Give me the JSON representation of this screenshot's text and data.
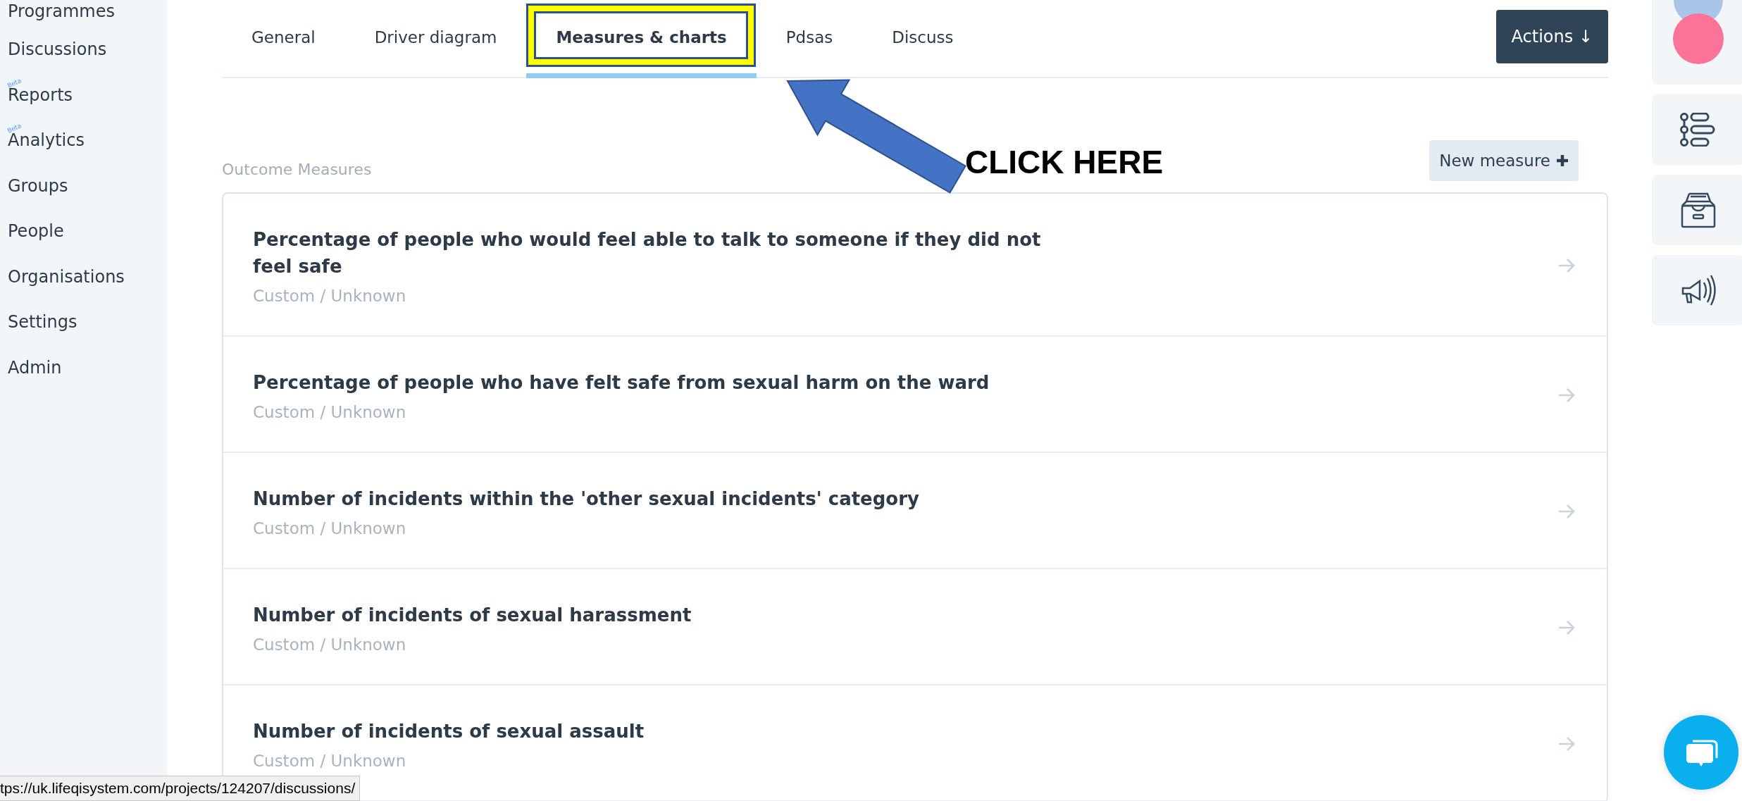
{
  "sidebar": {
    "items": [
      {
        "label": "Programmes"
      },
      {
        "label": "Discussions"
      },
      {
        "label": "Reports",
        "badge": "Beta"
      },
      {
        "label": "Analytics",
        "badge": "Beta"
      },
      {
        "label": "Groups"
      },
      {
        "label": "People"
      },
      {
        "label": "Organisations"
      },
      {
        "label": "Settings"
      },
      {
        "label": "Admin"
      }
    ]
  },
  "tabs": [
    {
      "label": "General",
      "selected": false,
      "highlighted": false
    },
    {
      "label": "Driver diagram",
      "selected": false,
      "highlighted": false
    },
    {
      "label": "Measures & charts",
      "selected": true,
      "highlighted": true
    },
    {
      "label": "Pdsas",
      "selected": false,
      "highlighted": false
    },
    {
      "label": "Discuss",
      "selected": false,
      "highlighted": false
    }
  ],
  "actions_button": "Actions ↓",
  "section": {
    "title": "Outcome Measures",
    "new_button": "New measure"
  },
  "measures": [
    {
      "title": "Percentage of people who would feel able to talk to someone if they did not feel safe",
      "subtitle": "Custom / Unknown"
    },
    {
      "title": "Percentage of people who have felt safe from sexual harm on the ward",
      "subtitle": "Custom / Unknown"
    },
    {
      "title": "Number of incidents within the 'other sexual incidents' category",
      "subtitle": "Custom / Unknown"
    },
    {
      "title": "Number of incidents of sexual harassment",
      "subtitle": "Custom / Unknown"
    },
    {
      "title": "Number of incidents of sexual assault",
      "subtitle": "Custom / Unknown"
    }
  ],
  "rail": [
    {
      "kind": "avatars"
    },
    {
      "kind": "tree"
    },
    {
      "kind": "archive"
    },
    {
      "kind": "megaphone"
    }
  ],
  "annotation": {
    "text": "CLICK HERE"
  },
  "status_url": "tps://uk.lifeqisystem.com/projects/124207/discussions/"
}
